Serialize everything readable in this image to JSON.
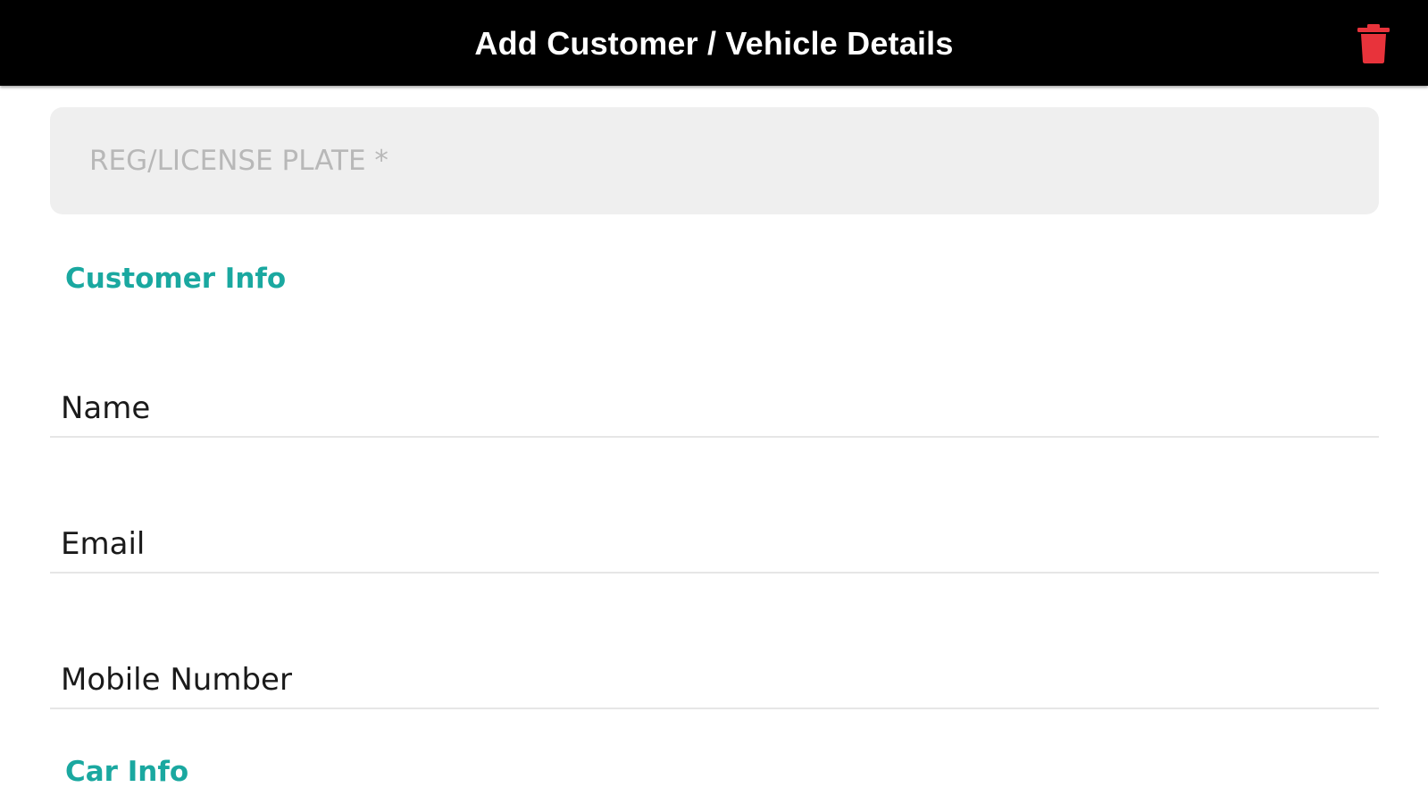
{
  "header": {
    "title": "Add Customer / Vehicle Details",
    "delete_icon": "trash-icon"
  },
  "plate": {
    "placeholder": "REG/LICENSE PLATE *",
    "value": ""
  },
  "sections": {
    "customer": "Customer Info",
    "car": "Car Info"
  },
  "fields": {
    "name": {
      "placeholder": "Name",
      "value": ""
    },
    "email": {
      "placeholder": "Email",
      "value": ""
    },
    "mobile": {
      "placeholder": "Mobile Number",
      "value": ""
    }
  },
  "colors": {
    "header_bg": "#000000",
    "accent": "#1aa8a0",
    "delete": "#e8333b",
    "input_bg": "#efefef"
  }
}
